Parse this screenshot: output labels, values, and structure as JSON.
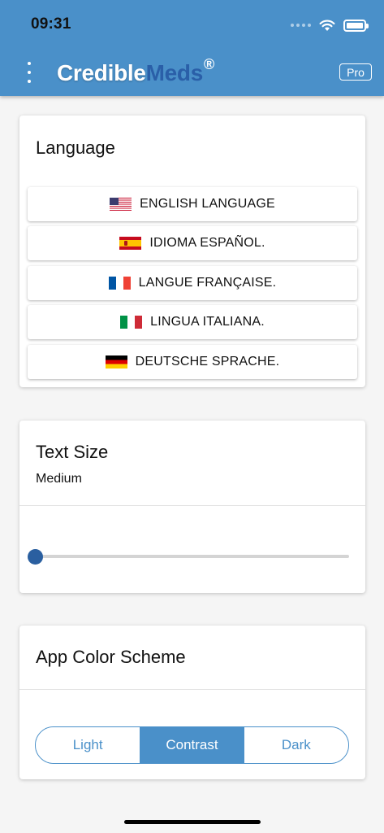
{
  "status_bar": {
    "time": "09:31"
  },
  "header": {
    "logo_part1": "Credible",
    "logo_part2": "Meds",
    "logo_registered": "®",
    "pro_label": "Pro"
  },
  "language_card": {
    "title": "Language",
    "options": [
      {
        "label": "ENGLISH LANGUAGE",
        "flag": "flag-us-icon"
      },
      {
        "label": "IDIOMA ESPAÑOL.",
        "flag": "flag-es-icon"
      },
      {
        "label": "LANGUE FRANÇAISE.",
        "flag": "flag-fr-icon"
      },
      {
        "label": "LINGUA ITALIANA.",
        "flag": "flag-it-icon"
      },
      {
        "label": "DEUTSCHE SPRACHE.",
        "flag": "flag-de-icon"
      }
    ]
  },
  "text_size_card": {
    "title": "Text Size",
    "current": "Medium",
    "slider_value": 0
  },
  "color_scheme_card": {
    "title": "App Color Scheme",
    "options": [
      "Light",
      "Contrast",
      "Dark"
    ],
    "selected": "Contrast"
  },
  "colors": {
    "header_bg": "#4a90c9",
    "logo_accent": "#2a5fa8",
    "slider_thumb": "#2a5fa0",
    "segment_active": "#4a90c9"
  }
}
